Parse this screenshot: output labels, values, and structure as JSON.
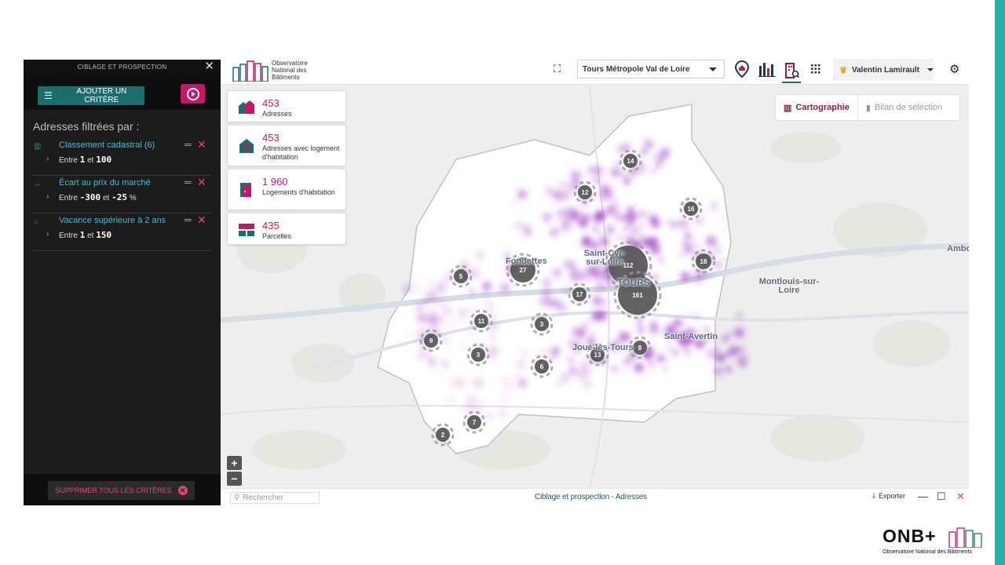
{
  "panel": {
    "title": "CIBLAGE ET PROSPECTION",
    "add_label": "AJOUTER UN CRITÈRE",
    "filters_heading": "Adresses filtrées par :",
    "delete_all_label": "SUPPRIMER TOUS LES CRITÈRES"
  },
  "filters": [
    {
      "label": "Classement cadastral (6)",
      "prefix": "Entre",
      "min": "1",
      "joiner": "et",
      "max": "100",
      "suffix": "",
      "icon": "building-icon"
    },
    {
      "label": "Écart au prix du marché",
      "prefix": "Entre",
      "min": "-300",
      "joiner": "et",
      "max": "-25",
      "suffix": "%",
      "icon": "arrows-icon"
    },
    {
      "label": "Vacance supérieure à 2 ans",
      "prefix": "Entre",
      "min": "1",
      "joiner": "et",
      "max": "150",
      "suffix": "",
      "icon": "house-icon"
    }
  ],
  "topbar": {
    "logo_line1": "Observatoire",
    "logo_line2": "National des",
    "logo_line3": "Bâtiments",
    "territory": "Tours Métropole Val de Loire",
    "user": "Valentin Lamirault"
  },
  "stats": [
    {
      "value": "453",
      "label": "Adresses"
    },
    {
      "value": "453",
      "label": "Adresses avec logement d'habitation"
    },
    {
      "value": "1 960",
      "label": "Logements d'habitation"
    },
    {
      "value": "435",
      "label": "Parcelles"
    }
  ],
  "view": {
    "map_label": "Cartographie",
    "summary_label": "Bilan de sélection"
  },
  "map": {
    "places": [
      {
        "name": "Fondettes"
      },
      {
        "name": "Saint-Cyr-sur-Loire"
      },
      {
        "name": "TOURS"
      },
      {
        "name": "Montlouis-sur-Loire"
      },
      {
        "name": "Joué-lès-Tours"
      },
      {
        "name": "Saint-Avertin"
      },
      {
        "name": "Ambo"
      }
    ],
    "clusters": [
      "14",
      "12",
      "16",
      "112",
      "18",
      "27",
      "5",
      "161",
      "17",
      "11",
      "3",
      "9",
      "3",
      "8",
      "13",
      "6",
      "7",
      "2"
    ]
  },
  "bottombar": {
    "search_placeholder": "Rechercher",
    "title": "Ciblage et prospection - Adresses",
    "export_label": "Exporter"
  },
  "onb": {
    "brand": "ONB+",
    "sub": "Observatoire National des Bâtiments"
  },
  "colors": {
    "accent": "#1c6e6e",
    "brand": "#c4176a",
    "cluster": "#555555",
    "density": "#9b2fbf"
  }
}
